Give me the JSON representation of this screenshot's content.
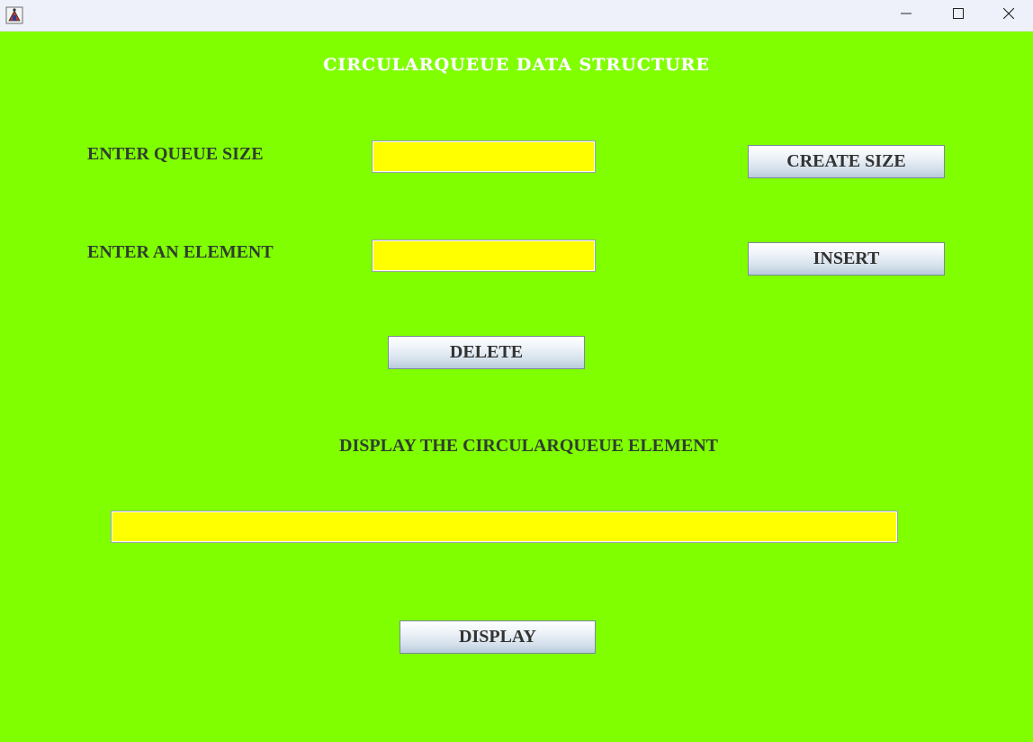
{
  "window": {
    "title": "",
    "controls": {
      "minimize_icon": "minimize-icon",
      "maximize_icon": "maximize-icon",
      "close_icon": "close-icon"
    }
  },
  "colors": {
    "background": "#80ff00",
    "field_background": "#ffff00",
    "heading_text": "#ffffff",
    "label_text": "#2f3f2f"
  },
  "heading": "CIRCULARQUEUE DATA STRUCTURE",
  "form": {
    "queue_size_label": "ENTER QUEUE SIZE",
    "queue_size_value": "",
    "create_size_button": "CREATE SIZE",
    "element_label": "ENTER AN ELEMENT",
    "element_value": "",
    "insert_button": "INSERT",
    "delete_button": "DELETE",
    "display_label": "DISPLAY THE CIRCULARQUEUE ELEMENT",
    "display_value": "",
    "display_button": "DISPLAY"
  }
}
